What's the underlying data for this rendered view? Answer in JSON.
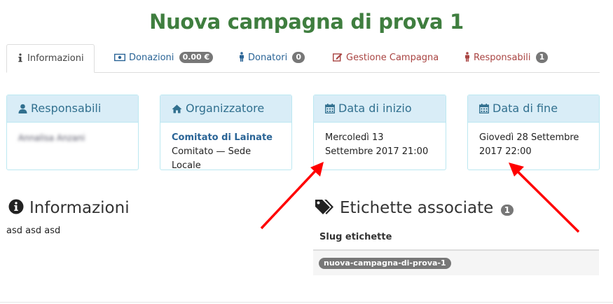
{
  "page": {
    "title": "Nuova campagna di prova 1"
  },
  "tabs": [
    {
      "label": "Informazioni",
      "icon": "info-icon",
      "color": "#444444"
    },
    {
      "label": "Donazioni",
      "badge": "0.00 €",
      "icon": "money-icon",
      "color": "#2a6496"
    },
    {
      "label": "Donatori",
      "badge": "0",
      "icon": "person-icon",
      "color": "#2a6496"
    },
    {
      "label": "Gestione Campagna",
      "icon": "edit-icon",
      "color": "#a94442"
    },
    {
      "label": "Responsabili",
      "badge": "1",
      "icon": "person-icon",
      "color": "#a94442"
    }
  ],
  "panels": {
    "responsabili": {
      "title": "Responsabili",
      "icon": "user-icon",
      "value": "Annalisa Anzani"
    },
    "organizzatore": {
      "title": "Organizzatore",
      "icon": "home-icon",
      "link": "Comitato di Lainate",
      "detail": "Comitato — Sede Locale"
    },
    "inizio": {
      "title": "Data di inizio",
      "icon": "calendar-icon",
      "value": "Mercoledì 13 Settembre 2017 21:00"
    },
    "fine": {
      "title": "Data di fine",
      "icon": "calendar-icon",
      "value": "Giovedì 28 Settembre 2017 22:00"
    }
  },
  "info": {
    "title": "Informazioni",
    "icon": "info-circle-icon",
    "text": "asd asd asd"
  },
  "tags": {
    "title": "Etichette associate",
    "icon": "tags-icon",
    "count": "1",
    "header": "Slug etichette",
    "items": [
      "nuova-campagna-di-prova-1"
    ]
  },
  "colors": {
    "title": "#3f7e3f",
    "panel_head": "#d9edf7",
    "panel_text": "#31708f",
    "arrow": "#ff0000"
  }
}
